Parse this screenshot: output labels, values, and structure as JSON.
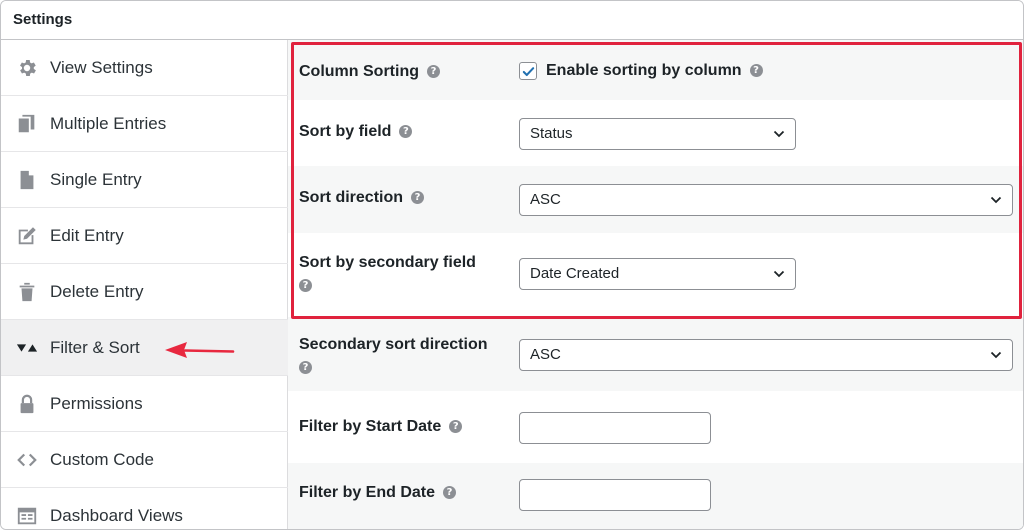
{
  "header": {
    "title": "Settings"
  },
  "sidebar": {
    "items": [
      {
        "label": "View Settings",
        "icon": "gear-icon"
      },
      {
        "label": "Multiple Entries",
        "icon": "copy-icon"
      },
      {
        "label": "Single Entry",
        "icon": "document-icon"
      },
      {
        "label": "Edit Entry",
        "icon": "edit-icon"
      },
      {
        "label": "Delete Entry",
        "icon": "trash-icon"
      },
      {
        "label": "Filter & Sort",
        "icon": "sort-icon",
        "active": true
      },
      {
        "label": "Permissions",
        "icon": "lock-icon"
      },
      {
        "label": "Custom Code",
        "icon": "code-icon"
      },
      {
        "label": "Dashboard Views",
        "icon": "table-icon"
      }
    ]
  },
  "settings": {
    "column_sorting": {
      "label": "Column Sorting",
      "checkbox_label": "Enable sorting by column",
      "checked": true
    },
    "sort_by_field": {
      "label": "Sort by field",
      "value": "Status"
    },
    "sort_direction": {
      "label": "Sort direction",
      "value": "ASC"
    },
    "sort_by_secondary_field": {
      "label": "Sort by secondary field",
      "value": "Date Created"
    },
    "secondary_sort_direction": {
      "label": "Secondary sort direction",
      "value": "ASC"
    },
    "filter_start_date": {
      "label": "Filter by Start Date",
      "value": ""
    },
    "filter_end_date": {
      "label": "Filter by End Date",
      "value": ""
    }
  },
  "help_glyph": "?",
  "colors": {
    "highlight": "#e0223d",
    "checkbox": "#2271b1",
    "active_nav": "#f0f0f1",
    "icon": "#8c8f94",
    "arrow": "#e8283f"
  }
}
